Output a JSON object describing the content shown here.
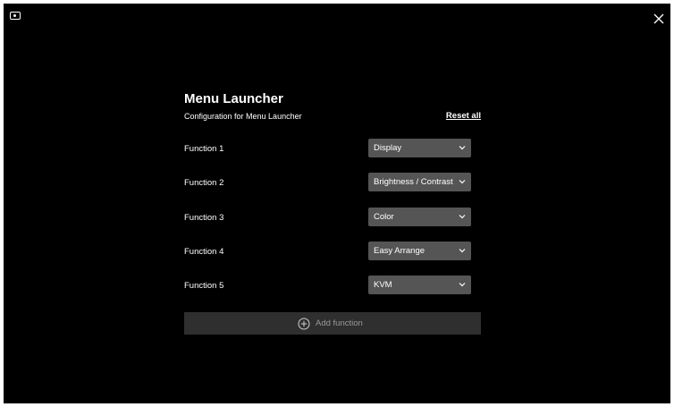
{
  "window": {
    "corner_icon": "monitor-icon",
    "close_icon": "close-icon"
  },
  "header": {
    "title": "Menu Launcher",
    "subtitle": "Configuration for Menu Launcher",
    "reset_label": "Reset all"
  },
  "functions": [
    {
      "label": "Function 1",
      "value": "Display"
    },
    {
      "label": "Function 2",
      "value": "Brightness / Contrast"
    },
    {
      "label": "Function 3",
      "value": "Color"
    },
    {
      "label": "Function 4",
      "value": "Easy Arrange"
    },
    {
      "label": "Function 5",
      "value": "KVM"
    }
  ],
  "add_button": {
    "label": "Add function",
    "icon": "plus-circle-icon"
  },
  "colors": {
    "background": "#000000",
    "dropdown": "#555555",
    "add_button": "#2f2f2f",
    "disabled_text": "#9a9a9a"
  }
}
